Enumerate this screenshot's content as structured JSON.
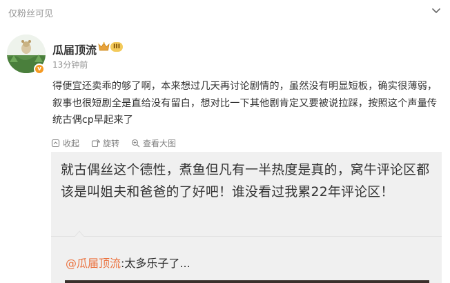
{
  "header": {
    "visibility_label": "仅粉丝可见",
    "chevron_icon": "chevron-down-icon"
  },
  "author": {
    "name": "瓜届顶流",
    "timestamp": "13分钟前",
    "level_badge": "III",
    "verified_badge_icon": "verified-v-icon",
    "crown_icon": "crown-icon"
  },
  "post": {
    "text": "得便宜还卖乖的够了啊，本来想过几天再讨论剧情的，虽然没有明显短板，确实很薄弱，叙事也很短剧全是直给没有留白，想对比一下其他剧肯定又要被说拉踩，按照这个声量传统古偶cp早起来了"
  },
  "actions": {
    "collect_label": "收起",
    "rotate_label": "旋转",
    "view_large_label": "查看大图"
  },
  "repost": {
    "text": "就古偶丝这个德性，煮鱼但凡有一半热度是真的，窝牛评论区都该是叫姐夫和爸爸的了好吧！谁没看过我累22年评论区！",
    "quote_mention": "@瓜届顶流",
    "quote_text": ":太多乐子了..."
  },
  "colors": {
    "accent_orange": "#eb7340",
    "muted_gray": "#939393",
    "card_bg": "#f0f0f0"
  }
}
